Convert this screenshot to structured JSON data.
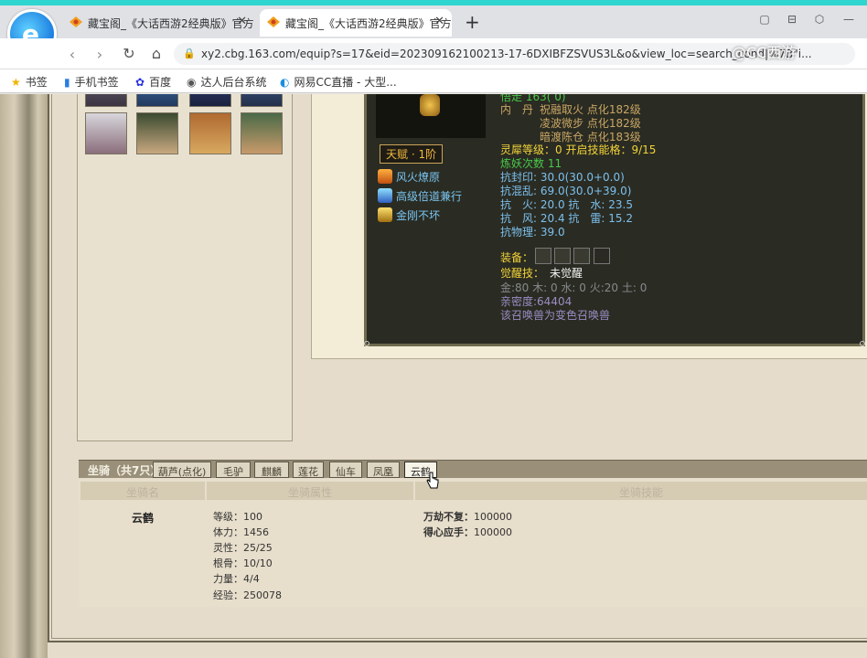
{
  "browser": {
    "tabs": [
      {
        "title": "藏宝阁_《大话西游2经典版》官方",
        "active": false
      },
      {
        "title": "藏宝阁_《大话西游2经典版》官方",
        "active": true
      }
    ],
    "url": "xy2.cbg.163.com/equip?s=17&eid=202309162100213-17-6DXIBFZSVUS3L&o&view_loc=search_cond|%7B\"i...",
    "watermark": "@CC西游",
    "bookmarks": [
      {
        "label": "书签",
        "icon": "star-icon"
      },
      {
        "label": "手机书签",
        "icon": "phone-icon"
      },
      {
        "label": "百度",
        "icon": "baidu-icon"
      },
      {
        "label": "达人后台系统",
        "icon": "link-icon"
      },
      {
        "label": "网易CC直播 - 大型...",
        "icon": "cc-icon"
      }
    ]
  },
  "pet": {
    "top_partial": "悟走 163( 0)",
    "talent": "天赋 · 1阶",
    "skills": [
      "风火燎原",
      "高级倍道兼行",
      "金刚不坏"
    ],
    "neidan_label": "内　丹",
    "neidan": [
      "祝融取火 点化182级",
      "凌波微步 点化182级",
      "暗渡陈仓 点化183级"
    ],
    "lingxi": "灵犀等级：0 开启技能格：9/15",
    "lianyao": "炼妖次数 11",
    "kangfengyin": "抗封印: 30.0(30.0+0.0)",
    "kanghunluan": "抗混乱: 69.0(30.0+39.0)",
    "kanghuoshui": "抗　火: 20.0 抗　水: 23.5",
    "kangfenglei": "抗　风: 20.4 抗　雷: 15.2",
    "kangwuli": "抗物理: 39.0",
    "equip_label": "装备：",
    "juexing_label": "觉醒技：",
    "juexing_value": "未觉醒",
    "wuxing": "金:80 木: 0 水: 0 火:20 土: 0",
    "qinmi": "亲密度:64404",
    "note": "该召唤兽为变色召唤兽"
  },
  "mount": {
    "title": "坐骑（共7只）",
    "tabs": [
      "葫芦(点化)",
      "毛驴",
      "麒麟",
      "莲花",
      "仙车",
      "凤凰",
      "云鹤"
    ],
    "active_tab": "云鹤",
    "columns": [
      "坐骑名",
      "坐骑属性",
      "坐骑技能"
    ],
    "name": "云鹤",
    "attributes": [
      "等级：100",
      "体力：1456",
      "灵性：25/25",
      "根骨：10/10",
      "力量：4/4",
      "经验：250078"
    ],
    "skills": [
      {
        "name": "万劫不复：",
        "value": "100000"
      },
      {
        "name": "得心应手：",
        "value": "100000"
      }
    ]
  }
}
